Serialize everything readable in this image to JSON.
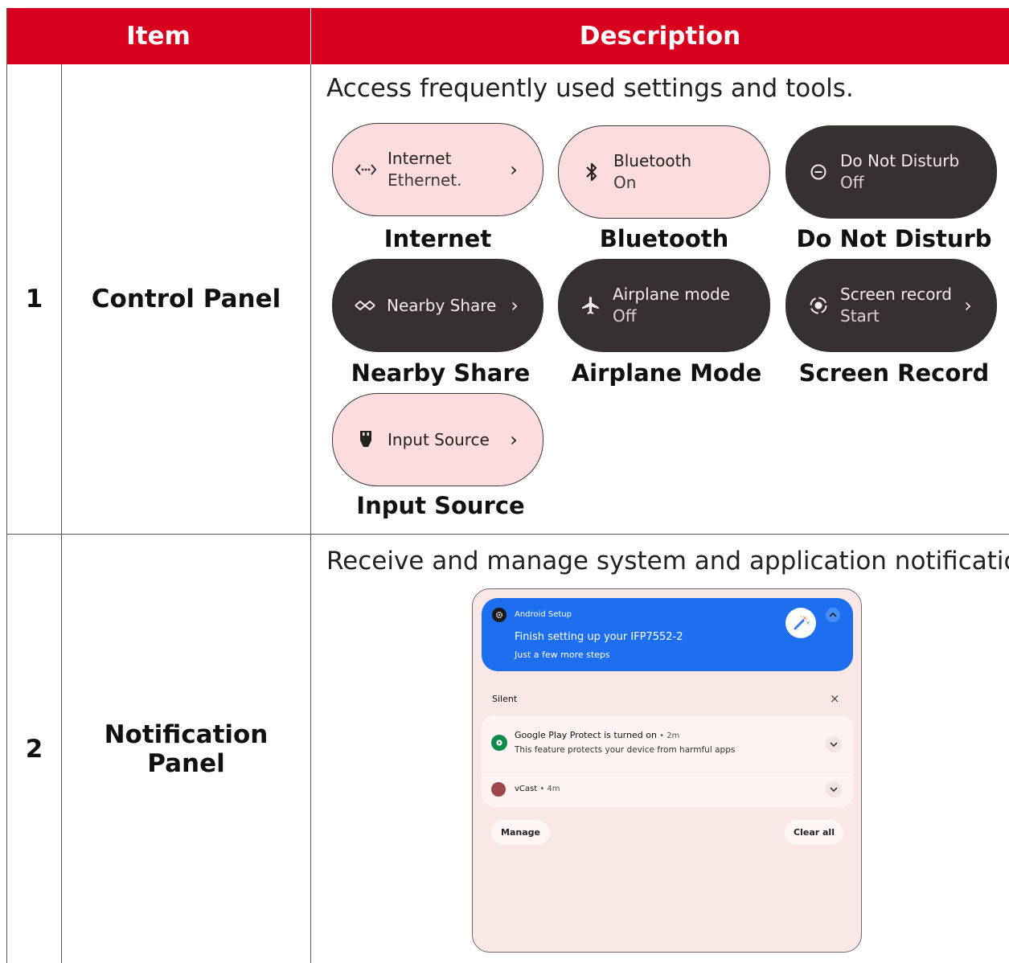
{
  "table": {
    "headers": {
      "item": "Item",
      "description": "Description"
    },
    "rows": [
      {
        "number": "1",
        "item": "Control Panel",
        "description": "Access frequently used settings and tools.",
        "tiles": [
          {
            "title": "Internet",
            "subtitle": "Ethernet.",
            "caption": "Internet",
            "style": "light",
            "icon": "ethernet-icon",
            "chevron": "›"
          },
          {
            "title": "Bluetooth",
            "subtitle": "On",
            "caption": "Bluetooth",
            "style": "light",
            "icon": "bluetooth-icon",
            "chevron": ""
          },
          {
            "title": "Do Not Disturb",
            "subtitle": "Off",
            "caption": "Do Not Disturb",
            "style": "dark",
            "icon": "dnd-icon",
            "chevron": ""
          },
          {
            "title": "Nearby Share",
            "subtitle": "",
            "caption": "Nearby Share",
            "style": "dark",
            "icon": "nearby-share-icon",
            "chevron": "›"
          },
          {
            "title": "Airplane mode",
            "subtitle": "Off",
            "caption": "Airplane Mode",
            "style": "dark",
            "icon": "airplane-icon",
            "chevron": ""
          },
          {
            "title": "Screen record",
            "subtitle": "Start",
            "caption": "Screen Record",
            "style": "dark",
            "icon": "screen-record-icon",
            "chevron": "›"
          },
          {
            "title": "Input Source",
            "subtitle": "",
            "caption": "Input Source",
            "style": "light",
            "icon": "input-source-icon",
            "chevron": "›"
          }
        ]
      },
      {
        "number": "2",
        "item": "Notification Panel",
        "description": "Receive and manage system and application notifications.",
        "panel": {
          "setup_app": "Android Setup",
          "setup_title": "Finish setting up your IFP7552-2",
          "setup_subtitle": "Just a few more steps",
          "section_label": "Silent",
          "close_glyph": "×",
          "notif1_title": "Google Play Protect is turned on",
          "notif1_time": " • 2m",
          "notif1_body": "This feature protects your device from harmful apps",
          "notif2_title": "vCast",
          "notif2_time": " • 4m",
          "manage_label": "Manage",
          "clear_label": "Clear all"
        }
      }
    ]
  },
  "colors": {
    "header_red": "#d9001f",
    "tile_light": "#fcdcdc",
    "tile_dark": "#363030",
    "notif_blue": "#1d6ff0"
  }
}
